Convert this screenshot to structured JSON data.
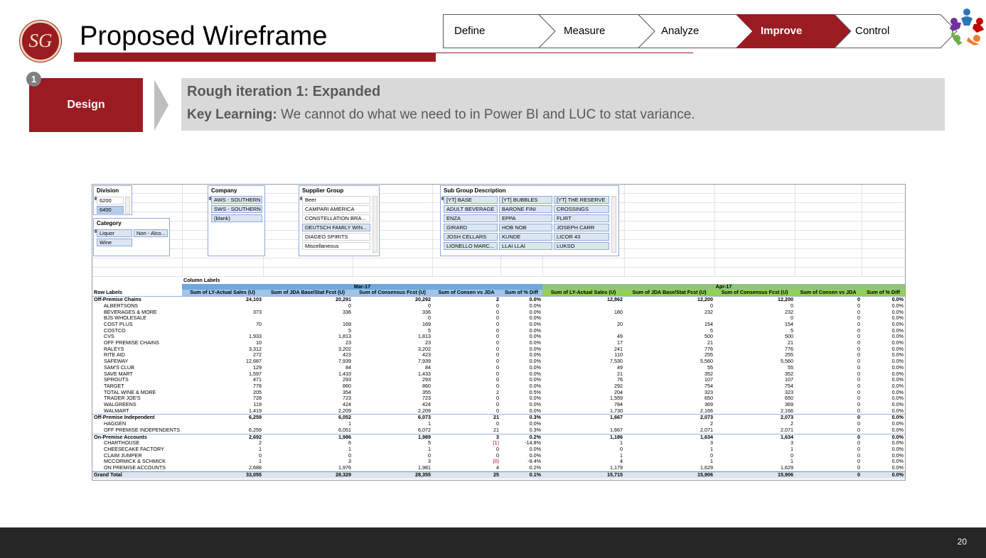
{
  "slide": {
    "title": "Proposed Wireframe",
    "logo_text": "SG",
    "page_number": "20",
    "steps": [
      {
        "label": "Define",
        "active": false
      },
      {
        "label": "Measure",
        "active": false
      },
      {
        "label": "Analyze",
        "active": false
      },
      {
        "label": "Improve",
        "active": true
      },
      {
        "label": "Control",
        "active": false
      }
    ],
    "badge": "1",
    "design_label": "Design",
    "iteration_title": "Rough iteration 1: Expanded",
    "key_learning_label": "Key Learning:",
    "key_learning_text": " We cannot do what we need to in Power BI and LUC to stat variance."
  },
  "colors": {
    "brand_red": "#9b1b23",
    "mar_header": "#6fa8dc",
    "apr_header": "#92d050"
  },
  "slicers": {
    "division": {
      "title": "Division",
      "items": [
        "6200",
        "6400"
      ]
    },
    "category": {
      "title": "Category",
      "items": [
        "Liquor",
        "Non - Alco...",
        "Wine"
      ]
    },
    "company": {
      "title": "Company",
      "items": [
        "AWS - SOUTHERN",
        "SWS - SOUTHERN",
        "(blank)"
      ]
    },
    "supplier": {
      "title": "Supplier Group",
      "items": [
        "Beer",
        "CAMPARI AMERICA",
        "CONSTELLATION BRA...",
        "DEUTSCH FAMILY WIN...",
        "DIAGEO SPIRITS",
        "Miscellaneous"
      ]
    },
    "subgroup": {
      "title": "Sub Group Description",
      "items": [
        "[YT] BASE",
        "[YT] BUBBLES",
        "[YT] THE RESERVE",
        "ADULT BEVERAGE",
        "BARONE FINI",
        "CROSSINGS",
        "ENZA",
        "EPPA",
        "FLIRT",
        "GIRARD",
        "HOB NOB",
        "JOSEPH CARR",
        "JOSH CELLARS",
        "KUNDE",
        "LICOR 43",
        "LIONELLO MARC...",
        "LLAI LLAI",
        "LUKSO"
      ]
    }
  },
  "pivot": {
    "column_labels": "Column Labels",
    "row_labels": "Row Labels",
    "months": [
      "Mar-17",
      "Apr-17"
    ],
    "columns": [
      "Sum of LY-Actual Sales (U)",
      "Sum of JDA Base/Stat Fcst (U)",
      "Sum of Consensus Fcst (U)",
      "Sum of Consen vs JDA",
      "Sum of % Diff"
    ],
    "rows": [
      {
        "type": "grp",
        "label": "Off-Premise Chains",
        "v": [
          "24,103",
          "20,291",
          "20,292",
          "2",
          "0.0%",
          "12,862",
          "12,200",
          "12,200",
          "0",
          "0.0%"
        ]
      },
      {
        "type": "sub",
        "label": "ALBERTSONS",
        "v": [
          "",
          "0",
          "0",
          "0",
          "0.0%",
          "",
          "0",
          "0",
          "0",
          "0.0%"
        ]
      },
      {
        "type": "sub",
        "label": "BEVERAGES & MORE",
        "v": [
          "373",
          "336",
          "336",
          "0",
          "0.0%",
          "180",
          "232",
          "232",
          "0",
          "0.0%"
        ]
      },
      {
        "type": "sub",
        "label": "BJS WHOLESALE",
        "v": [
          "",
          "",
          "0",
          "0",
          "0.0%",
          "",
          "",
          "0",
          "0",
          "0.0%"
        ]
      },
      {
        "type": "sub",
        "label": "COST PLUS",
        "v": [
          "70",
          "169",
          "169",
          "0",
          "0.0%",
          "20",
          "154",
          "154",
          "0",
          "0.0%"
        ]
      },
      {
        "type": "sub",
        "label": "COSTCO",
        "v": [
          "",
          "5",
          "5",
          "0",
          "0.0%",
          "",
          "5",
          "5",
          "0",
          "0.0%"
        ]
      },
      {
        "type": "sub",
        "label": "CVS",
        "v": [
          "1,933",
          "1,813",
          "1,813",
          "0",
          "0.0%",
          "49",
          "500",
          "500",
          "0",
          "0.0%"
        ]
      },
      {
        "type": "sub",
        "label": "OFF PREMISE CHAINS",
        "v": [
          "10",
          "23",
          "23",
          "0",
          "0.0%",
          "17",
          "21",
          "21",
          "0",
          "0.0%"
        ]
      },
      {
        "type": "sub",
        "label": "RALEYS",
        "v": [
          "3,312",
          "3,202",
          "3,202",
          "0",
          "0.0%",
          "241",
          "776",
          "776",
          "0",
          "0.0%"
        ]
      },
      {
        "type": "sub",
        "label": "RITE AID",
        "v": [
          "272",
          "423",
          "423",
          "0",
          "0.0%",
          "110",
          "255",
          "255",
          "0",
          "0.0%"
        ]
      },
      {
        "type": "sub",
        "label": "SAFEWAY",
        "v": [
          "12,687",
          "7,939",
          "7,939",
          "0",
          "0.0%",
          "7,530",
          "5,560",
          "5,560",
          "0",
          "0.0%"
        ]
      },
      {
        "type": "sub",
        "label": "SAM'S CLUB",
        "v": [
          "129",
          "84",
          "84",
          "0",
          "0.0%",
          "49",
          "55",
          "55",
          "0",
          "0.0%"
        ]
      },
      {
        "type": "sub",
        "label": "SAVE MART",
        "v": [
          "1,597",
          "1,433",
          "1,433",
          "0",
          "0.0%",
          "21",
          "352",
          "352",
          "0",
          "0.0%"
        ]
      },
      {
        "type": "sub",
        "label": "SPROUTS",
        "v": [
          "471",
          "293",
          "293",
          "0",
          "0.0%",
          "76",
          "107",
          "107",
          "0",
          "0.0%"
        ]
      },
      {
        "type": "sub",
        "label": "TARGET",
        "v": [
          "778",
          "860",
          "860",
          "0",
          "0.0%",
          "292",
          "754",
          "754",
          "0",
          "0.0%"
        ]
      },
      {
        "type": "sub",
        "label": "TOTAL WINE & MORE",
        "v": [
          "205",
          "354",
          "355",
          "2",
          "0.5%",
          "204",
          "323",
          "323",
          "0",
          "0.0%"
        ]
      },
      {
        "type": "sub",
        "label": "TRADER JOE'S",
        "v": [
          "728",
          "723",
          "723",
          "0",
          "0.0%",
          "1,559",
          "650",
          "650",
          "0",
          "0.0%"
        ]
      },
      {
        "type": "sub",
        "label": "WALGREENS",
        "v": [
          "119",
          "424",
          "424",
          "0",
          "0.0%",
          "784",
          "369",
          "369",
          "0",
          "0.0%"
        ]
      },
      {
        "type": "sub",
        "label": "WALMART",
        "v": [
          "1,419",
          "2,209",
          "2,209",
          "0",
          "0.0%",
          "1,730",
          "2,166",
          "2,166",
          "0",
          "0.0%"
        ]
      },
      {
        "type": "grp",
        "label": "Off-Premise Independent",
        "v": [
          "6,259",
          "6,052",
          "6,073",
          "21",
          "0.3%",
          "1,667",
          "2,073",
          "2,073",
          "0",
          "0.0%"
        ]
      },
      {
        "type": "sub",
        "label": "HAGGEN",
        "v": [
          "",
          "1",
          "1",
          "0",
          "0.0%",
          "",
          "2",
          "2",
          "0",
          "0.0%"
        ]
      },
      {
        "type": "sub",
        "label": "OFF PREMISE INDEPENDENTS",
        "v": [
          "6,259",
          "6,051",
          "6,072",
          "21",
          "0.3%",
          "1,667",
          "2,071",
          "2,071",
          "0",
          "0.0%"
        ]
      },
      {
        "type": "grp",
        "label": "On-Premise Accounts",
        "v": [
          "2,692",
          "1,986",
          "1,989",
          "3",
          "0.2%",
          "1,186",
          "1,634",
          "1,634",
          "0",
          "0.0%"
        ]
      },
      {
        "type": "sub",
        "label": "CHARTHOUSE",
        "v": [
          "2",
          "6",
          "5",
          "(1)",
          "-14.8%",
          "1",
          "3",
          "3",
          "0",
          "0.0%"
        ]
      },
      {
        "type": "sub",
        "label": "CHEESECAKE FACTORY",
        "v": [
          "1",
          "1",
          "1",
          "0",
          "0.0%",
          "0",
          "1",
          "1",
          "0",
          "0.0%"
        ]
      },
      {
        "type": "sub",
        "label": "CLAIM JUMPER",
        "v": [
          "0",
          "0",
          "0",
          "0",
          "0.0%",
          "1",
          "0",
          "0",
          "0",
          "0.0%"
        ]
      },
      {
        "type": "sub",
        "label": "MCCORMICK & SCHMICK",
        "v": [
          "1",
          "3",
          "3",
          "(0)",
          "-9.4%",
          "4",
          "1",
          "1",
          "0",
          "0.0%"
        ]
      },
      {
        "type": "sub",
        "label": "ON PREMISE ACCOUNTS",
        "v": [
          "2,688",
          "1,976",
          "1,981",
          "4",
          "0.2%",
          "1,179",
          "1,629",
          "1,629",
          "0",
          "0.0%"
        ]
      },
      {
        "type": "total",
        "label": "Grand Total",
        "v": [
          "33,055",
          "28,329",
          "28,355",
          "25",
          "0.1%",
          "15,715",
          "15,906",
          "15,906",
          "0",
          "0.0%"
        ]
      }
    ]
  }
}
